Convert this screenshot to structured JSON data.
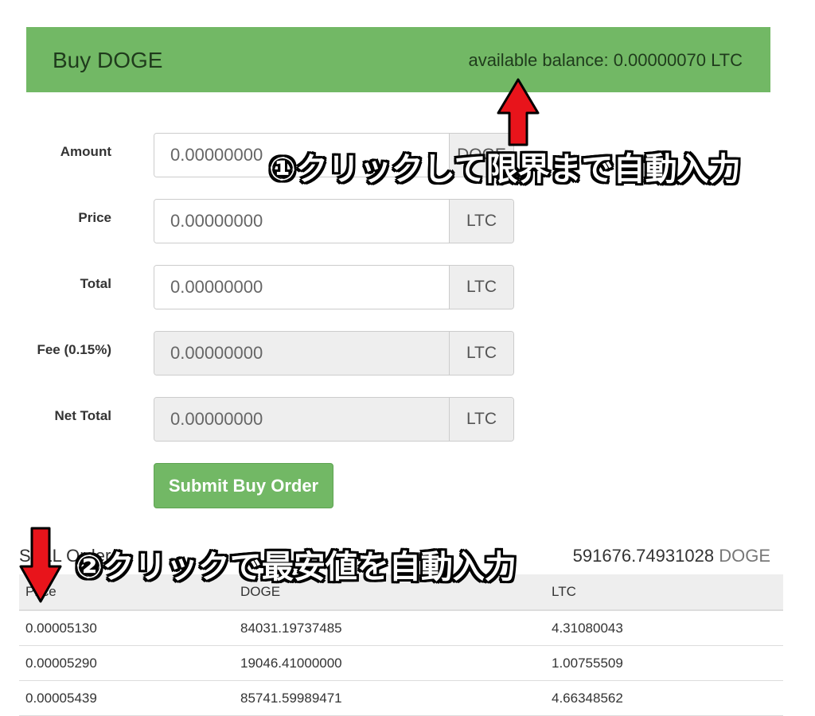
{
  "header": {
    "title": "Buy DOGE",
    "balance_label": "available balance: ",
    "balance_value": "0.00000070",
    "balance_unit": "LTC"
  },
  "form": {
    "rows": [
      {
        "label": "Amount",
        "placeholder": "0.00000000",
        "unit": "DOGE"
      },
      {
        "label": "Price",
        "placeholder": "0.00000000",
        "unit": "LTC"
      },
      {
        "label": "Total",
        "placeholder": "0.00000000",
        "unit": "LTC"
      },
      {
        "label": "Fee (0.15%)",
        "placeholder": "0.00000000",
        "unit": "LTC"
      },
      {
        "label": "Net Total",
        "placeholder": "0.00000000",
        "unit": "LTC"
      }
    ],
    "submit_label": "Submit Buy Order"
  },
  "sell_orders": {
    "title": "SELL Orders",
    "total_value": "591676.74931028",
    "total_unit": "DOGE",
    "columns": [
      "Price",
      "DOGE",
      "LTC"
    ],
    "rows": [
      [
        "0.00005130",
        "84031.19737485",
        "4.31080043"
      ],
      [
        "0.00005290",
        "19046.41000000",
        "1.00755509"
      ],
      [
        "0.00005439",
        "85741.59989471",
        "4.66348562"
      ]
    ]
  },
  "annotations": {
    "note1": "①クリックして限界まで自動入力",
    "note2": "②クリックで最安値を自動入力",
    "arrow_color": "#e8141b"
  }
}
